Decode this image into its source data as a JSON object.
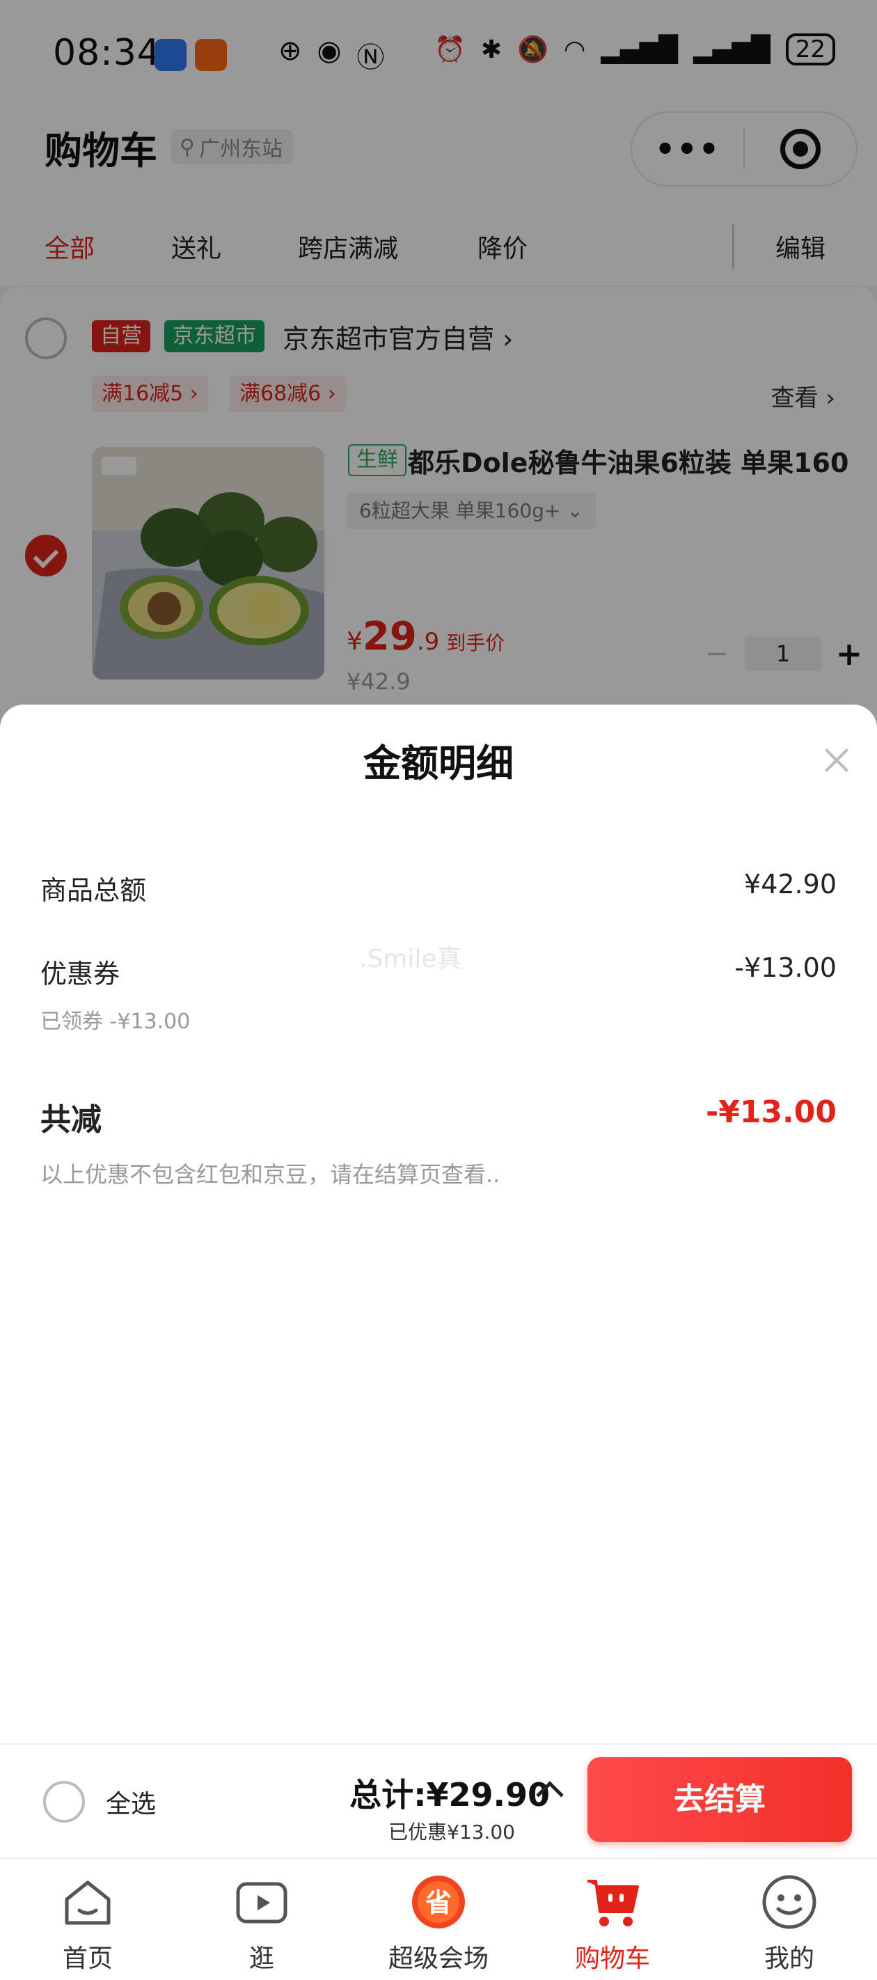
{
  "status_bar": {
    "time": "08:34",
    "battery": "22"
  },
  "header": {
    "title": "购物车",
    "location": "广州东站",
    "more_icon": "more-dots-icon",
    "target_icon": "target-icon"
  },
  "tabs": [
    {
      "label": "全部",
      "active": true
    },
    {
      "label": "送礼",
      "active": false
    },
    {
      "label": "跨店满减",
      "active": false
    },
    {
      "label": "降价",
      "active": false
    }
  ],
  "edit_label": "编辑",
  "shop": {
    "tag_self": "自营",
    "tag_market": "京东超市",
    "name": "京东超市官方自营 ›",
    "promos": [
      "满16减5 ›",
      "满68减6 ›"
    ],
    "view_more": "查看 ›"
  },
  "product": {
    "fresh_tag": "生鲜",
    "title": "都乐Dole秘鲁牛油果6粒装 单果160",
    "spec": "6粒超大果 单果160g+  ⌄",
    "price_yen": "¥",
    "price_int": "29",
    "price_dec": ".9",
    "price_label": "到手价",
    "original_price": "¥42.9",
    "quantity": "1",
    "minus": "−",
    "plus": "+"
  },
  "sheet": {
    "title": "金额明细",
    "goods_total_label": "商品总额",
    "goods_total_value": "¥42.90",
    "coupon_label": "优惠券",
    "coupon_value": "-¥13.00",
    "coupon_sub": "已领券 -¥13.00",
    "watermark": ".Smile真",
    "total_reduce_label": "共减",
    "total_reduce_value": "-¥13.00",
    "note": "以上优惠不包含红包和京豆，请在结算页查看.."
  },
  "checkout": {
    "select_all": "全选",
    "total": "总计:¥29.90",
    "saved": "已优惠¥13.00",
    "button": "去结算"
  },
  "tabbar": [
    {
      "label": "首页",
      "icon": "home-icon",
      "active": false
    },
    {
      "label": "逛",
      "icon": "play-icon",
      "active": false
    },
    {
      "label": "超级会场",
      "icon": "super-venue-icon",
      "active": false
    },
    {
      "label": "购物车",
      "icon": "cart-icon",
      "active": true
    },
    {
      "label": "我的",
      "icon": "smile-face-icon",
      "active": false
    }
  ],
  "colors": {
    "accent": "#e2231a",
    "fresh_green": "#2eaa5a",
    "market_green": "#1a9f5e"
  }
}
